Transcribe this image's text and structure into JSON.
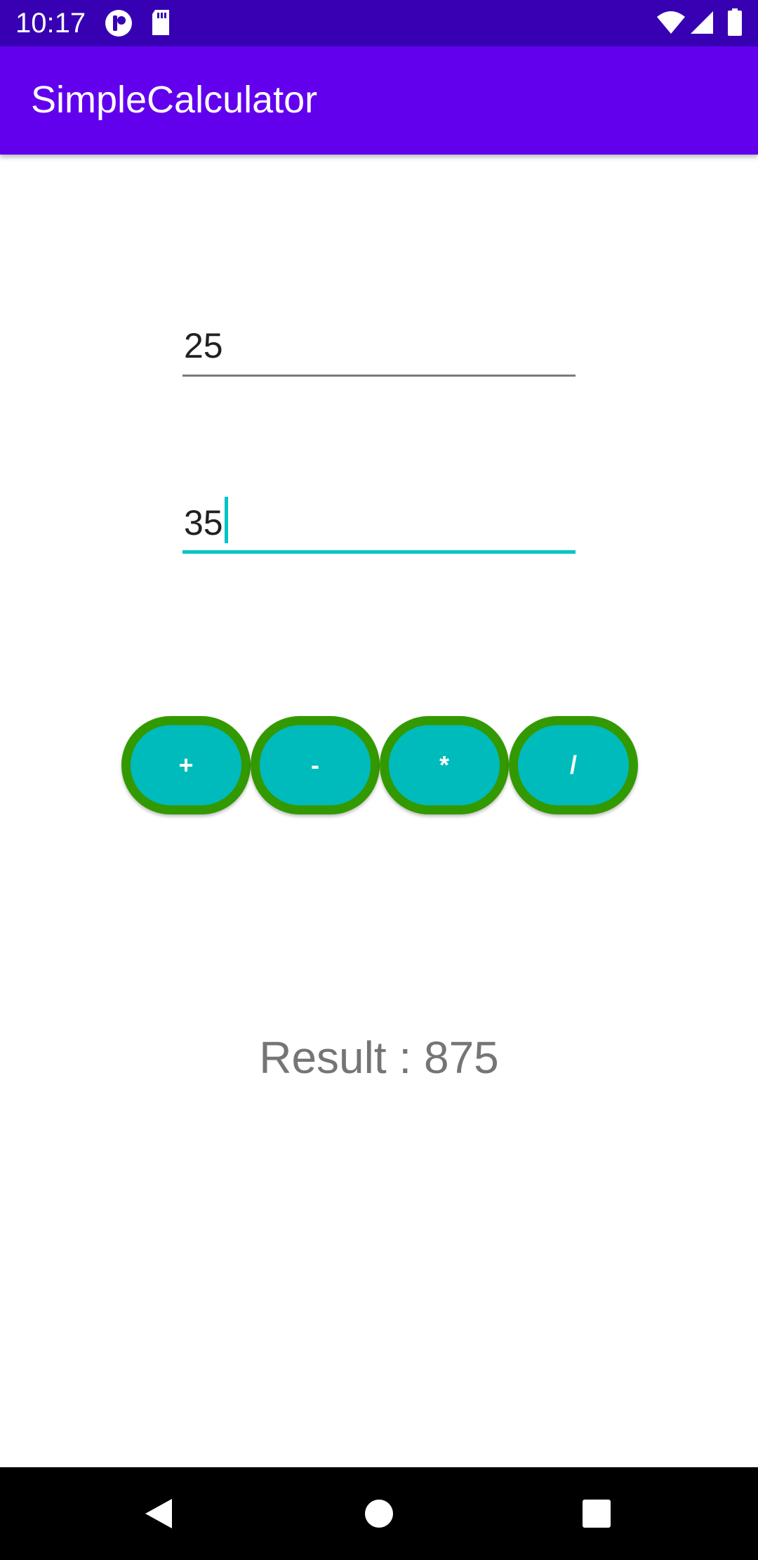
{
  "status_bar": {
    "time": "10:17",
    "left_icons": [
      "notification-icon",
      "sd-card-icon"
    ],
    "right_icons": [
      "wifi-icon",
      "cell-signal-icon",
      "battery-icon"
    ]
  },
  "app_bar": {
    "title": "SimpleCalculator"
  },
  "inputs": {
    "first_number": "25",
    "second_number": "35"
  },
  "operations": [
    {
      "label": "+"
    },
    {
      "label": "-"
    },
    {
      "label": "*"
    },
    {
      "label": "/"
    }
  ],
  "result": {
    "text": "Result : 875"
  },
  "colors": {
    "status_bar": "#3700b3",
    "app_bar": "#6200ee",
    "button_fill": "#00bbbb",
    "button_border": "#339900",
    "focus_accent": "#00c5c5"
  },
  "nav_bar": {
    "buttons": [
      "back-icon",
      "home-icon",
      "recents-icon"
    ]
  }
}
